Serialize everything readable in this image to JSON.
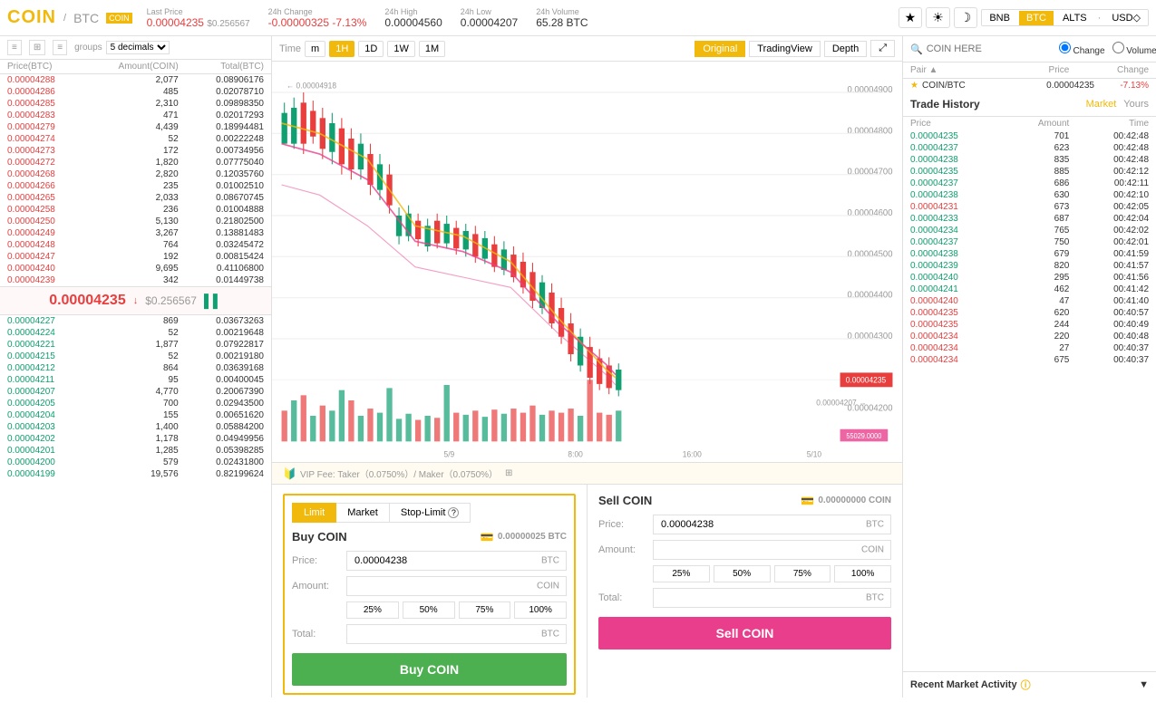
{
  "header": {
    "coin": "COIN",
    "slash": "/",
    "base": "BTC",
    "badge": "COIN",
    "last_price_label": "Last Price",
    "last_price": "0.00004235",
    "last_price_usd": "$0.256567",
    "change_label": "24h Change",
    "change_val": "-0.00000325",
    "change_pct": "-7.13%",
    "high_label": "24h High",
    "high_val": "0.00004560",
    "low_label": "24h Low",
    "low_val": "0.00004207",
    "volume_label": "24h Volume",
    "volume_val": "65.28 BTC"
  },
  "nav": {
    "bnb": "BNB",
    "btc": "BTC",
    "alts": "ALTS",
    "dot": "·",
    "usd": "USD◇",
    "search_placeholder": "COIN HERE",
    "change_label": "Change",
    "volume_label": "Volume"
  },
  "pair_header": {
    "pair": "Pair",
    "price": "Price",
    "change": "Change"
  },
  "pairs": [
    {
      "star": true,
      "name": "COIN/BTC",
      "price": "0.00004235",
      "change": "-7.13%"
    }
  ],
  "order_book": {
    "groups_label": "groups",
    "decimals": "5 decimals",
    "cols": [
      "Price(BTC)",
      "Amount(COIN)",
      "Total(BTC)"
    ],
    "sell_orders": [
      [
        "0.00004288",
        "2,077",
        "0.08906176"
      ],
      [
        "0.00004286",
        "485",
        "0.02078710"
      ],
      [
        "0.00004285",
        "2,310",
        "0.09898350"
      ],
      [
        "0.00004283",
        "471",
        "0.02017293"
      ],
      [
        "0.00004279",
        "4,439",
        "0.18994481"
      ],
      [
        "0.00004274",
        "52",
        "0.00222248"
      ],
      [
        "0.00004273",
        "172",
        "0.00734956"
      ],
      [
        "0.00004272",
        "1,820",
        "0.07775040"
      ],
      [
        "0.00004268",
        "2,820",
        "0.12035760"
      ],
      [
        "0.00004266",
        "235",
        "0.01002510"
      ],
      [
        "0.00004265",
        "2,033",
        "0.08670745"
      ],
      [
        "0.00004258",
        "236",
        "0.01004888"
      ],
      [
        "0.00004250",
        "5,130",
        "0.21802500"
      ],
      [
        "0.00004249",
        "3,267",
        "0.13881483"
      ],
      [
        "0.00004248",
        "764",
        "0.03245472"
      ],
      [
        "0.00004247",
        "192",
        "0.00815424"
      ],
      [
        "0.00004240",
        "9,695",
        "0.41106800"
      ],
      [
        "0.00004239",
        "342",
        "0.01449738"
      ]
    ],
    "current_price": "0.00004235",
    "current_price_usd": "$0.256567",
    "buy_orders": [
      [
        "0.00004227",
        "869",
        "0.03673263"
      ],
      [
        "0.00004224",
        "52",
        "0.00219648"
      ],
      [
        "0.00004221",
        "1,877",
        "0.07922817"
      ],
      [
        "0.00004215",
        "52",
        "0.00219180"
      ],
      [
        "0.00004212",
        "864",
        "0.03639168"
      ],
      [
        "0.00004211",
        "95",
        "0.00400045"
      ],
      [
        "0.00004207",
        "4,770",
        "0.20067390"
      ],
      [
        "0.00004205",
        "700",
        "0.02943500"
      ],
      [
        "0.00004204",
        "155",
        "0.00651620"
      ],
      [
        "0.00004203",
        "1,400",
        "0.05884200"
      ],
      [
        "0.00004202",
        "1,178",
        "0.04949956"
      ],
      [
        "0.00004201",
        "1,285",
        "0.05398285"
      ],
      [
        "0.00004200",
        "579",
        "0.02431800"
      ],
      [
        "0.00004199",
        "19,576",
        "0.82199624"
      ]
    ]
  },
  "chart_toolbar": {
    "time_label": "Time",
    "intervals": [
      "m",
      "1H",
      "1D",
      "1W",
      "1M"
    ],
    "active_interval": "1H",
    "view_buttons": [
      "Original",
      "TradingView",
      "Depth"
    ],
    "active_view": "Original",
    "expand_icon": "⤢"
  },
  "trade_form": {
    "tabs": [
      "Limit",
      "Market",
      "Stop-Limit"
    ],
    "active_tab": "Limit",
    "help_icon": "?",
    "vip_text": "VIP  Fee: Taker（0.0750%）/ Maker（0.0750%）",
    "buy": {
      "title": "Buy COIN",
      "balance": "0.00000025 BTC",
      "price_label": "Price:",
      "price_val": "0.00004238",
      "price_unit": "BTC",
      "amount_label": "Amount:",
      "amount_val": "",
      "amount_unit": "COIN",
      "pct_btns": [
        "25%",
        "50%",
        "75%",
        "100%"
      ],
      "total_label": "Total:",
      "total_val": "",
      "total_unit": "BTC",
      "btn": "Buy COIN"
    },
    "sell": {
      "title": "Sell COIN",
      "balance": "0.00000000 COIN",
      "price_label": "Price:",
      "price_val": "0.00004238",
      "price_unit": "BTC",
      "amount_label": "Amount:",
      "amount_val": "",
      "amount_unit": "COIN",
      "pct_btns": [
        "25%",
        "50%",
        "75%",
        "100%"
      ],
      "total_label": "Total:",
      "total_val": "",
      "total_unit": "BTC",
      "btn": "Sell COIN"
    }
  },
  "trade_history": {
    "title": "Trade History",
    "tabs": [
      "Market",
      "Yours"
    ],
    "active_tab": "Market",
    "cols": [
      "Price",
      "Amount",
      "Time"
    ],
    "rows": [
      [
        "0.00004235",
        "701",
        "00:42:48",
        "up"
      ],
      [
        "0.00004237",
        "623",
        "00:42:48",
        "up"
      ],
      [
        "0.00004238",
        "835",
        "00:42:48",
        "up"
      ],
      [
        "0.00004235",
        "885",
        "00:42:12",
        "up"
      ],
      [
        "0.00004237",
        "686",
        "00:42:11",
        "up"
      ],
      [
        "0.00004238",
        "630",
        "00:42:10",
        "up"
      ],
      [
        "0.00004231",
        "673",
        "00:42:05",
        "dn"
      ],
      [
        "0.00004233",
        "687",
        "00:42:04",
        "up"
      ],
      [
        "0.00004234",
        "765",
        "00:42:02",
        "up"
      ],
      [
        "0.00004237",
        "750",
        "00:42:01",
        "up"
      ],
      [
        "0.00004238",
        "679",
        "00:41:59",
        "up"
      ],
      [
        "0.00004239",
        "820",
        "00:41:57",
        "up"
      ],
      [
        "0.00004240",
        "295",
        "00:41:56",
        "up"
      ],
      [
        "0.00004241",
        "462",
        "00:41:42",
        "up"
      ],
      [
        "0.00004240",
        "47",
        "00:41:40",
        "dn"
      ],
      [
        "0.00004235",
        "620",
        "00:40:57",
        "dn"
      ],
      [
        "0.00004235",
        "244",
        "00:40:49",
        "dn"
      ],
      [
        "0.00004234",
        "220",
        "00:40:48",
        "dn"
      ],
      [
        "0.00004234",
        "27",
        "00:40:37",
        "dn"
      ],
      [
        "0.00004234",
        "675",
        "00:40:37",
        "dn"
      ]
    ]
  },
  "rma": {
    "label": "Recent Market Activity",
    "arrow": "▼"
  }
}
